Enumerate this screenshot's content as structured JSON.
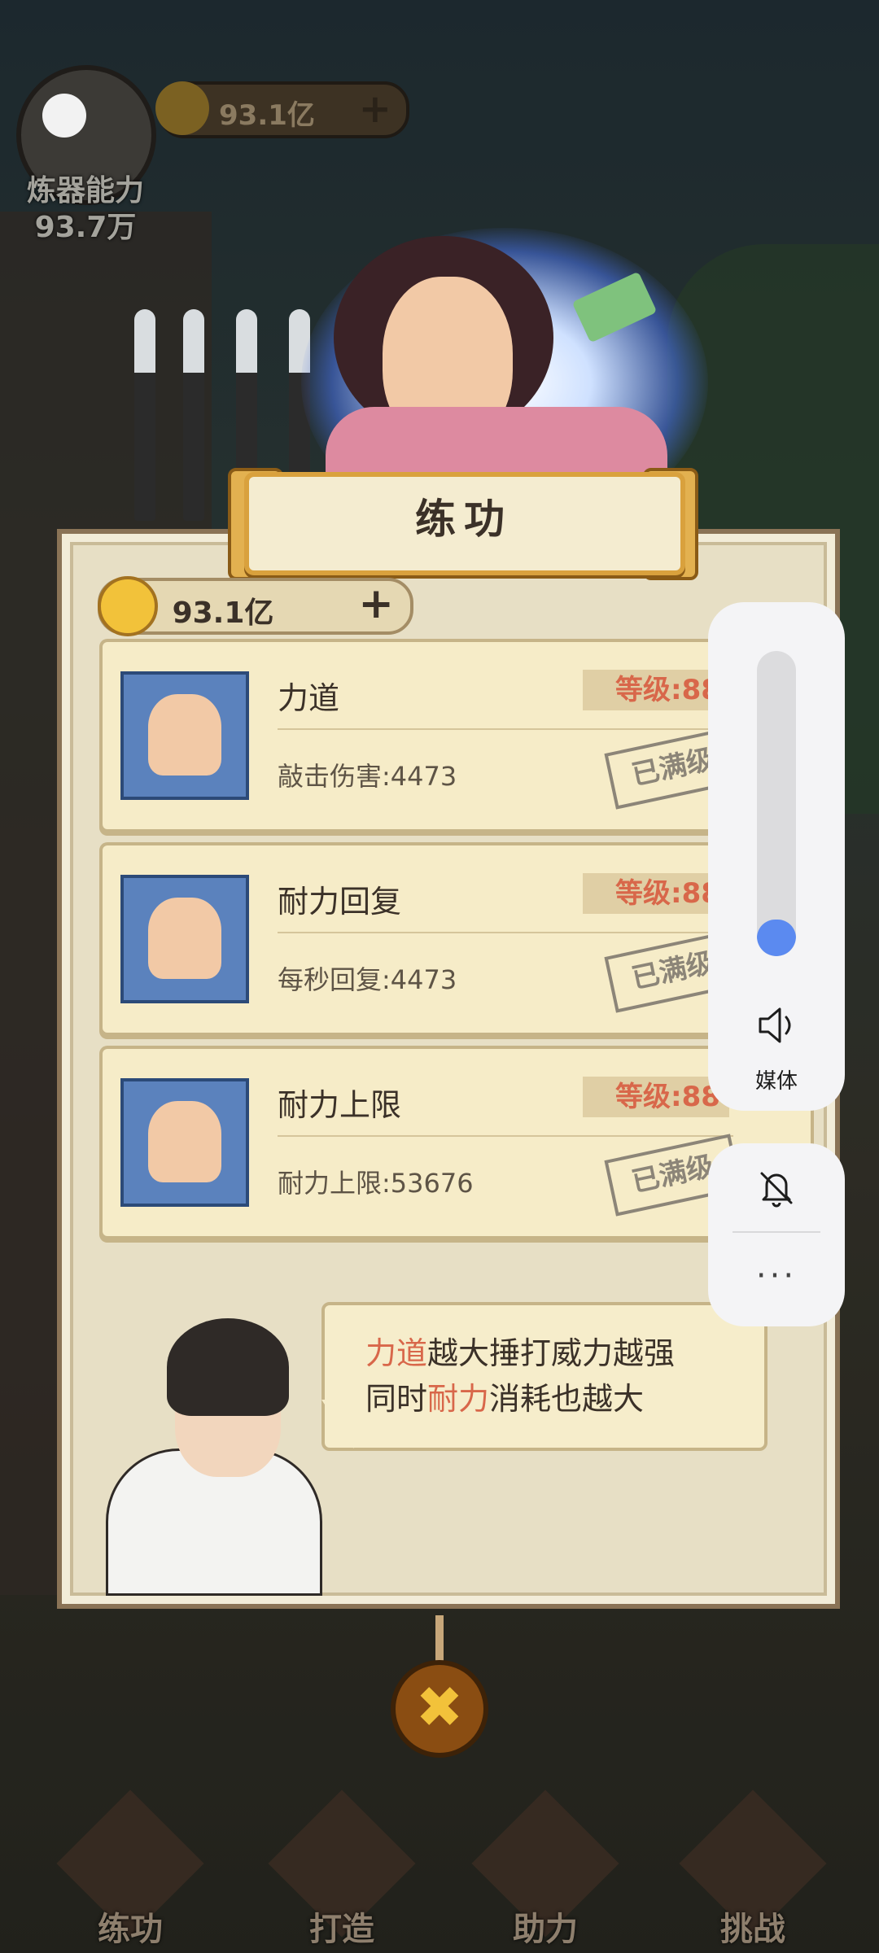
{
  "hud": {
    "power_label": "炼器能力",
    "power_value": "93.7万",
    "coins": "93.1亿"
  },
  "dialog": {
    "title": "练功",
    "coins": "93.1亿",
    "items": [
      {
        "name": "力道",
        "stat": "敲击伤害:4473",
        "level": "等级:88",
        "status": "已满级",
        "icon": "hammer-icon"
      },
      {
        "name": "耐力回复",
        "stat": "每秒回复:4473",
        "level": "等级:88",
        "status": "已满级",
        "icon": "flex-arm-icon"
      },
      {
        "name": "耐力上限",
        "stat": "耐力上限:53676",
        "level": "等级:88",
        "status": "已满级",
        "icon": "arm-up-arrow-icon"
      }
    ],
    "hint": {
      "line1_em": "力道",
      "line1_rest": "越大捶打威力越强",
      "line2_pre": "同时",
      "line2_em": "耐力",
      "line2_rest": "消耗也越大"
    }
  },
  "nav": [
    {
      "label": "练功",
      "icon": "sword-icon"
    },
    {
      "label": "打造",
      "icon": "anvil-icon"
    },
    {
      "label": "助力",
      "icon": "helper-icon"
    },
    {
      "label": "挑战",
      "icon": "crossed-swords-icon"
    }
  ],
  "volume": {
    "level": 0.12,
    "label": "媒体",
    "more": "···"
  },
  "colors": {
    "accent_red": "#d8674a",
    "volume_blue": "#5b8af0",
    "gold": "#f2c23a"
  }
}
